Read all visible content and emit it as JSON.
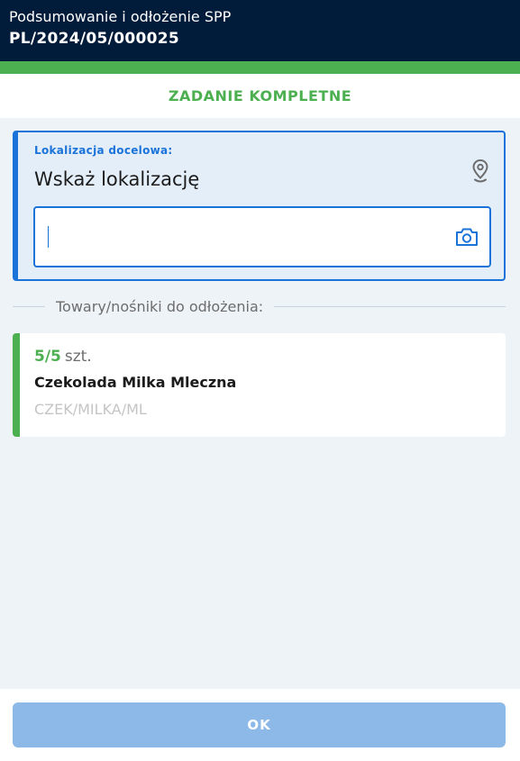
{
  "header": {
    "title": "Podsumowanie i odłożenie SPP",
    "document_number": "PL/2024/05/000025"
  },
  "status": {
    "label": "ZADANIE KOMPLETNE",
    "color": "#4caf50"
  },
  "location": {
    "label": "Lokalizacja docelowa:",
    "prompt": "Wskaż lokalizację",
    "input_value": "",
    "icons": [
      "map-pin-icon",
      "camera-icon"
    ]
  },
  "goods_section": {
    "label": "Towary/nośniki do odłożenia:"
  },
  "items": [
    {
      "quantity": "5/5",
      "unit": "szt.",
      "name": "Czekolada Milka Mleczna",
      "code": "CZEK/MILKA/ML"
    }
  ],
  "footer": {
    "ok_label": "OK"
  },
  "colors": {
    "header_bg": "#011b3a",
    "accent_blue": "#1a73d9",
    "success_green": "#4caf50",
    "button_disabled": "#8cb9e8"
  }
}
